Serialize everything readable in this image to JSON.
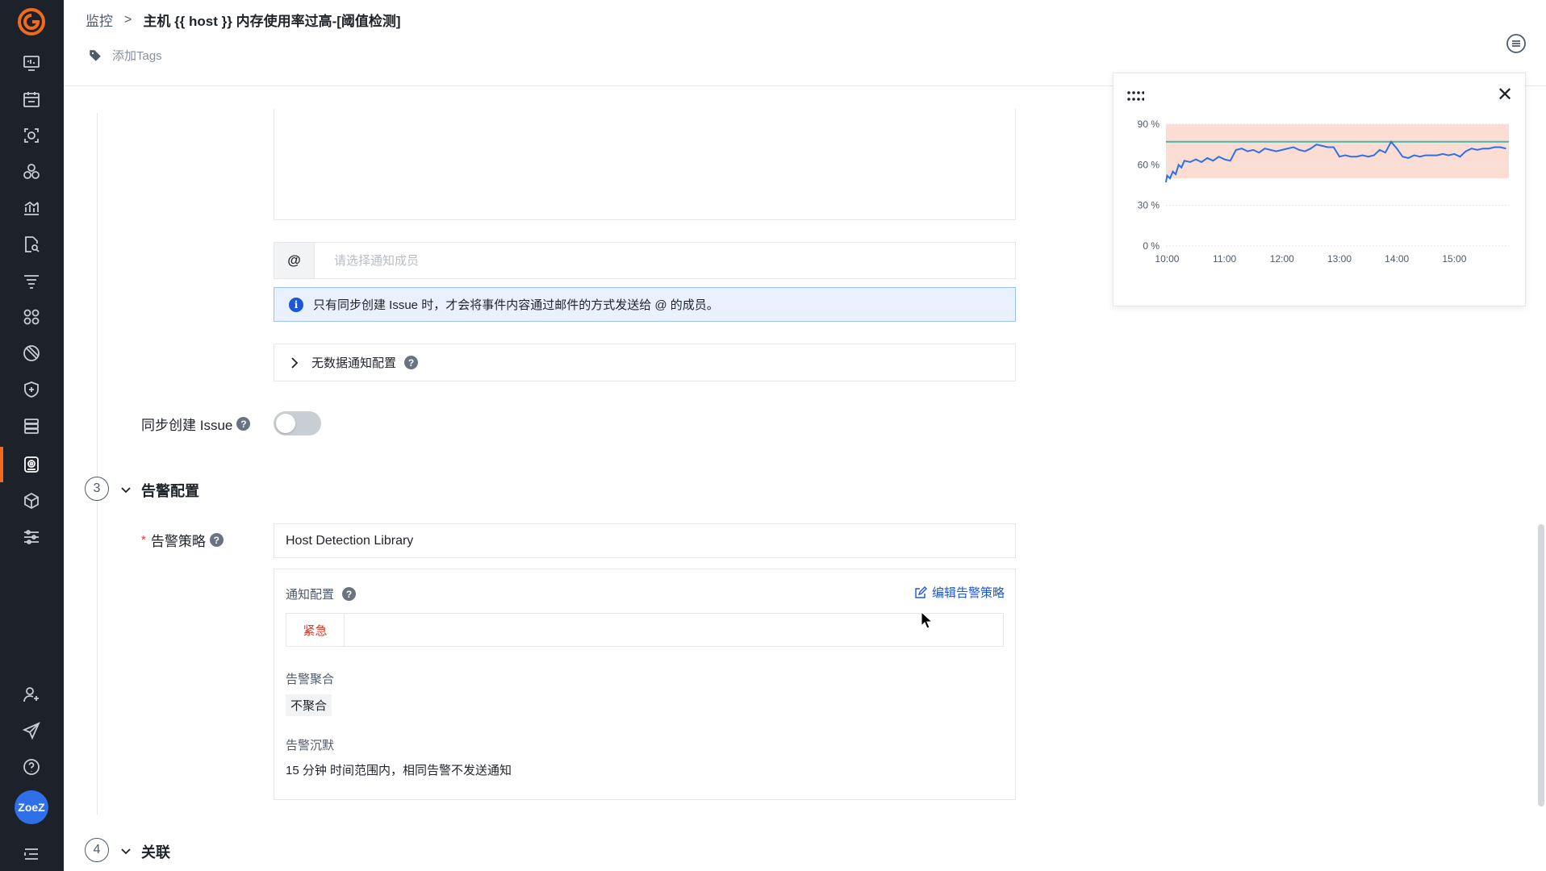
{
  "header": {
    "breadcrumb_root": "监控",
    "breadcrumb_sep": ">",
    "title": "主机 {{ host }} 内存使用率过高-[阈值检测]",
    "add_tags": "添加Tags"
  },
  "sidebar": {
    "icons": [
      "dashboard-icon",
      "calendar-icon",
      "scan-icon",
      "cluster-icon",
      "chart-icon",
      "search-doc-icon",
      "filter-list-icon",
      "apps-icon",
      "disabled-icon",
      "shield-icon",
      "stack-icon",
      "monitor-icon",
      "cube-icon",
      "settings-sliders-icon"
    ],
    "bottom_icons": [
      "user-add-icon",
      "send-icon",
      "help-icon"
    ],
    "avatar_label": "ZoeZ"
  },
  "notify": {
    "at_prefix": "@",
    "member_placeholder": "请选择通知成员",
    "info_text": "只有同步创建 Issue 时，才会将事件内容通过邮件的方式发送给 @ 的成员。",
    "info_icon": "i",
    "nodata_label": "无数据通知配置",
    "help_mark": "?"
  },
  "sync_issue": {
    "label": "同步创建 Issue",
    "enabled": false
  },
  "section3": {
    "number": "3",
    "title": "告警配置",
    "strategy_label": "告警策略",
    "strategy_value": "Host Detection Library",
    "notify_config_label": "通知配置",
    "edit_link": "编辑告警策略",
    "level": "紧急",
    "aggregation_label": "告警聚合",
    "aggregation_value": "不聚合",
    "silence_label": "告警沉默",
    "silence_value": "15 分钟 时间范围内，相同告警不发送通知"
  },
  "section4": {
    "number": "4",
    "title": "关联"
  },
  "chart_data": {
    "type": "line",
    "y_ticks": [
      "90 %",
      "60 %",
      "30 %",
      "0 %"
    ],
    "x_ticks": [
      "10:00",
      "11:00",
      "12:00",
      "13:00",
      "14:00",
      "15:00"
    ],
    "ylim": [
      0,
      90
    ],
    "threshold_band": [
      50,
      90
    ],
    "threshold_line": 77,
    "series": [
      {
        "color": "#2f6fe8",
        "x": [
          9.98,
          10.0,
          10.05,
          10.1,
          10.15,
          10.2,
          10.25,
          10.3,
          10.4,
          10.5,
          10.6,
          10.7,
          10.8,
          10.9,
          11.0,
          11.1,
          11.2,
          11.3,
          11.4,
          11.5,
          11.6,
          11.7,
          11.8,
          11.9,
          12.0,
          12.1,
          12.2,
          12.3,
          12.4,
          12.5,
          12.6,
          12.7,
          12.8,
          12.9,
          13.0,
          13.1,
          13.2,
          13.3,
          13.4,
          13.5,
          13.6,
          13.7,
          13.8,
          13.9,
          14.0,
          14.1,
          14.2,
          14.3,
          14.4,
          14.5,
          14.6,
          14.7,
          14.8,
          14.9,
          15.0,
          15.1,
          15.2,
          15.3,
          15.4,
          15.5,
          15.6,
          15.7,
          15.8,
          15.9
        ],
        "values": [
          47,
          52,
          50,
          55,
          53,
          60,
          58,
          63,
          62,
          64,
          62,
          65,
          63,
          66,
          64,
          63,
          71,
          72,
          70,
          71,
          69,
          72,
          71,
          70,
          71,
          72,
          73,
          71,
          70,
          72,
          75,
          74,
          73,
          73,
          66,
          67,
          66,
          66,
          67,
          66,
          67,
          71,
          69,
          77,
          72,
          66,
          65,
          67,
          66,
          67,
          67,
          67,
          68,
          67,
          68,
          66,
          70,
          72,
          71,
          72,
          72,
          73,
          73,
          72
        ]
      }
    ]
  }
}
